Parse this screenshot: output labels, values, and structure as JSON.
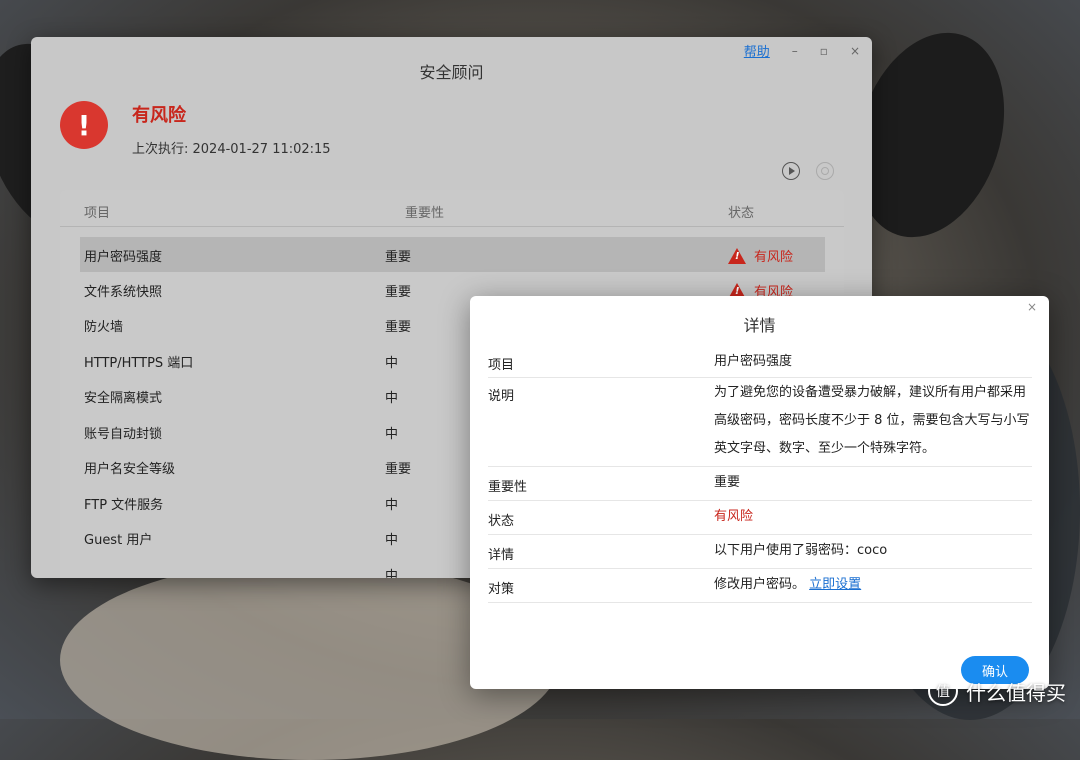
{
  "window": {
    "title": "安全顾问",
    "help": "帮助",
    "minimize": "–",
    "maximize": "▫",
    "close": "×"
  },
  "status": {
    "title": "有风险",
    "last_run": "上次执行: 2024-01-27 11:02:15",
    "icon": "!"
  },
  "table": {
    "headers": [
      "项目",
      "重要性",
      "状态"
    ],
    "rows": [
      {
        "item": "用户密码强度",
        "importance": "重要",
        "status": "有风险"
      },
      {
        "item": "文件系统快照",
        "importance": "重要",
        "status": "有风险"
      },
      {
        "item": "防火墙",
        "importance": "重要",
        "status": ""
      },
      {
        "item": "HTTP/HTTPS 端口",
        "importance": "中",
        "status": ""
      },
      {
        "item": "安全隔离模式",
        "importance": "中",
        "status": ""
      },
      {
        "item": "账号自动封锁",
        "importance": "中",
        "status": ""
      },
      {
        "item": "用户名安全等级",
        "importance": "重要",
        "status": ""
      },
      {
        "item": "FTP 文件服务",
        "importance": "中",
        "status": ""
      },
      {
        "item": "Guest 用户",
        "importance": "中",
        "status": ""
      },
      {
        "item": "",
        "importance": "中",
        "status": ""
      }
    ]
  },
  "dialog": {
    "title": "详情",
    "close": "×",
    "rows": [
      {
        "label": "项目",
        "value": "用户密码强度"
      },
      {
        "label": "说明",
        "value": "为了避免您的设备遭受暴力破解，建议所有用户都采用高级密码，密码长度不少于 8 位，需要包含大写与小写英文字母、数字、至少一个特殊字符。"
      },
      {
        "label": "重要性",
        "value": "重要"
      },
      {
        "label": "状态",
        "value": "有风险"
      },
      {
        "label": "详情",
        "value": "以下用户使用了弱密码：coco"
      },
      {
        "label": "对策",
        "value": "修改用户密码。",
        "link": "立即设置"
      }
    ],
    "ok": "确认"
  },
  "watermark": {
    "icon": "值",
    "text": "什么值得买"
  },
  "colors": {
    "risk": "#c8261c",
    "accent": "#1a8cf0",
    "link": "#1a6fd1"
  }
}
